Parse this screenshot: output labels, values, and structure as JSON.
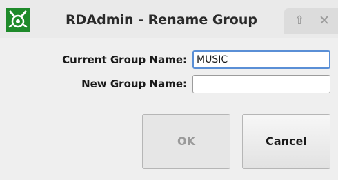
{
  "window": {
    "title": "RDAdmin - Rename Group",
    "controls": {
      "up_glyph": "⇧",
      "close_glyph": "✕"
    }
  },
  "form": {
    "current_label": "Current Group Name:",
    "current_value": "MUSIC",
    "new_label": "New Group Name:",
    "new_value": ""
  },
  "buttons": {
    "ok_label": "OK",
    "cancel_label": "Cancel"
  },
  "colors": {
    "app_icon_bg": "#1e8a2a",
    "focus_border": "#5a8fd6",
    "disabled_text": "#9a9a9a"
  },
  "state": {
    "ok_enabled": false,
    "focused_field": "current"
  }
}
